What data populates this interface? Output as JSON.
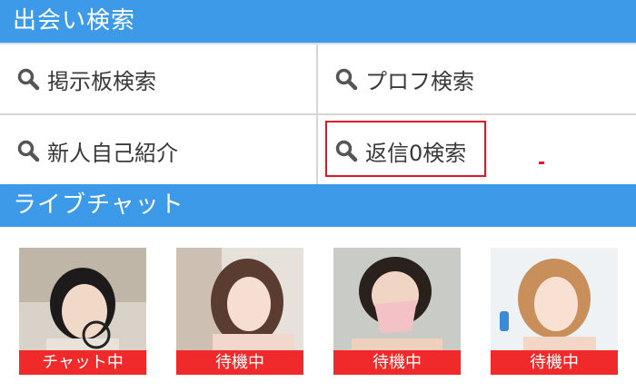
{
  "search_section": {
    "title": "出会い検索",
    "items": [
      {
        "label": "掲示板検索",
        "icon": "search-icon"
      },
      {
        "label": "プロフ検索",
        "icon": "search-icon"
      },
      {
        "label": "新人自己紹介",
        "icon": "search-icon"
      },
      {
        "label": "返信0検索",
        "icon": "search-icon",
        "highlighted": true
      }
    ]
  },
  "live_section": {
    "title": "ライブチャット",
    "performers": [
      {
        "status": "チャット中"
      },
      {
        "status": "待機中"
      },
      {
        "status": "待機中"
      },
      {
        "status": "待機中"
      }
    ]
  },
  "colors": {
    "header_bg": "#3d9ae8",
    "status_bg": "#f02a2a",
    "highlight": "#e0162b"
  }
}
